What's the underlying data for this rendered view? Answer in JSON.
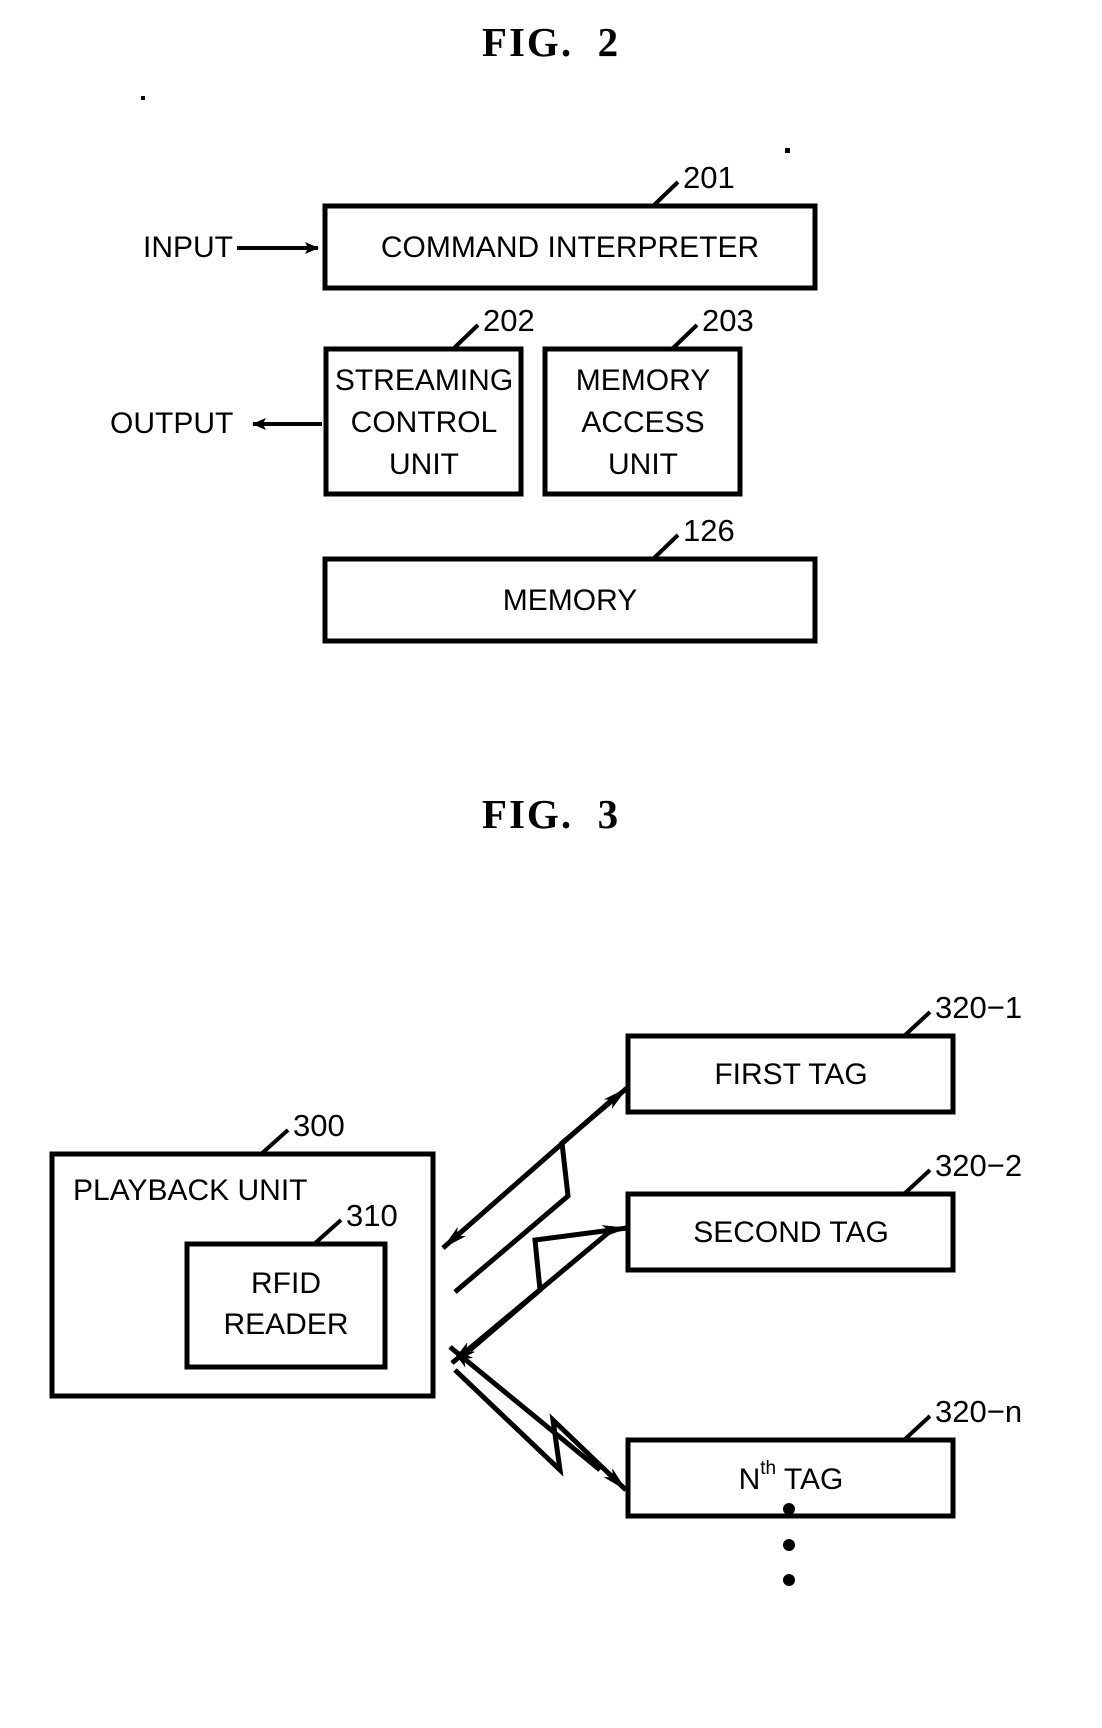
{
  "figures": [
    {
      "title": "FIG.  2",
      "io_labels": {
        "input": "INPUT",
        "output": "OUTPUT"
      },
      "blocks": [
        {
          "ref": "201",
          "label": "COMMAND INTERPRETER",
          "lines": [
            "COMMAND INTERPRETER"
          ]
        },
        {
          "ref": "202",
          "label": "STREAMING CONTROL UNIT",
          "lines": [
            "STREAMING",
            "CONTROL",
            "UNIT"
          ]
        },
        {
          "ref": "203",
          "label": "MEMORY ACCESS UNIT",
          "lines": [
            "MEMORY",
            "ACCESS",
            "UNIT"
          ]
        },
        {
          "ref": "126",
          "label": "MEMORY",
          "lines": [
            "MEMORY"
          ]
        }
      ]
    },
    {
      "title": "FIG.  3",
      "blocks": [
        {
          "ref": "300",
          "label": "PLAYBACK UNIT",
          "lines": [
            "PLAYBACK UNIT"
          ]
        },
        {
          "ref": "310",
          "label": "RFID READER",
          "lines": [
            "RFID",
            "READER"
          ]
        },
        {
          "ref": "320−1",
          "label": "FIRST TAG",
          "lines": [
            "FIRST TAG"
          ]
        },
        {
          "ref": "320−2",
          "label": "SECOND TAG",
          "lines": [
            "SECOND TAG"
          ]
        },
        {
          "ref": "320−n",
          "label": "N th TAG",
          "lines": [
            "N",
            "th",
            " TAG"
          ]
        }
      ],
      "ellipsis": "⋮"
    }
  ]
}
